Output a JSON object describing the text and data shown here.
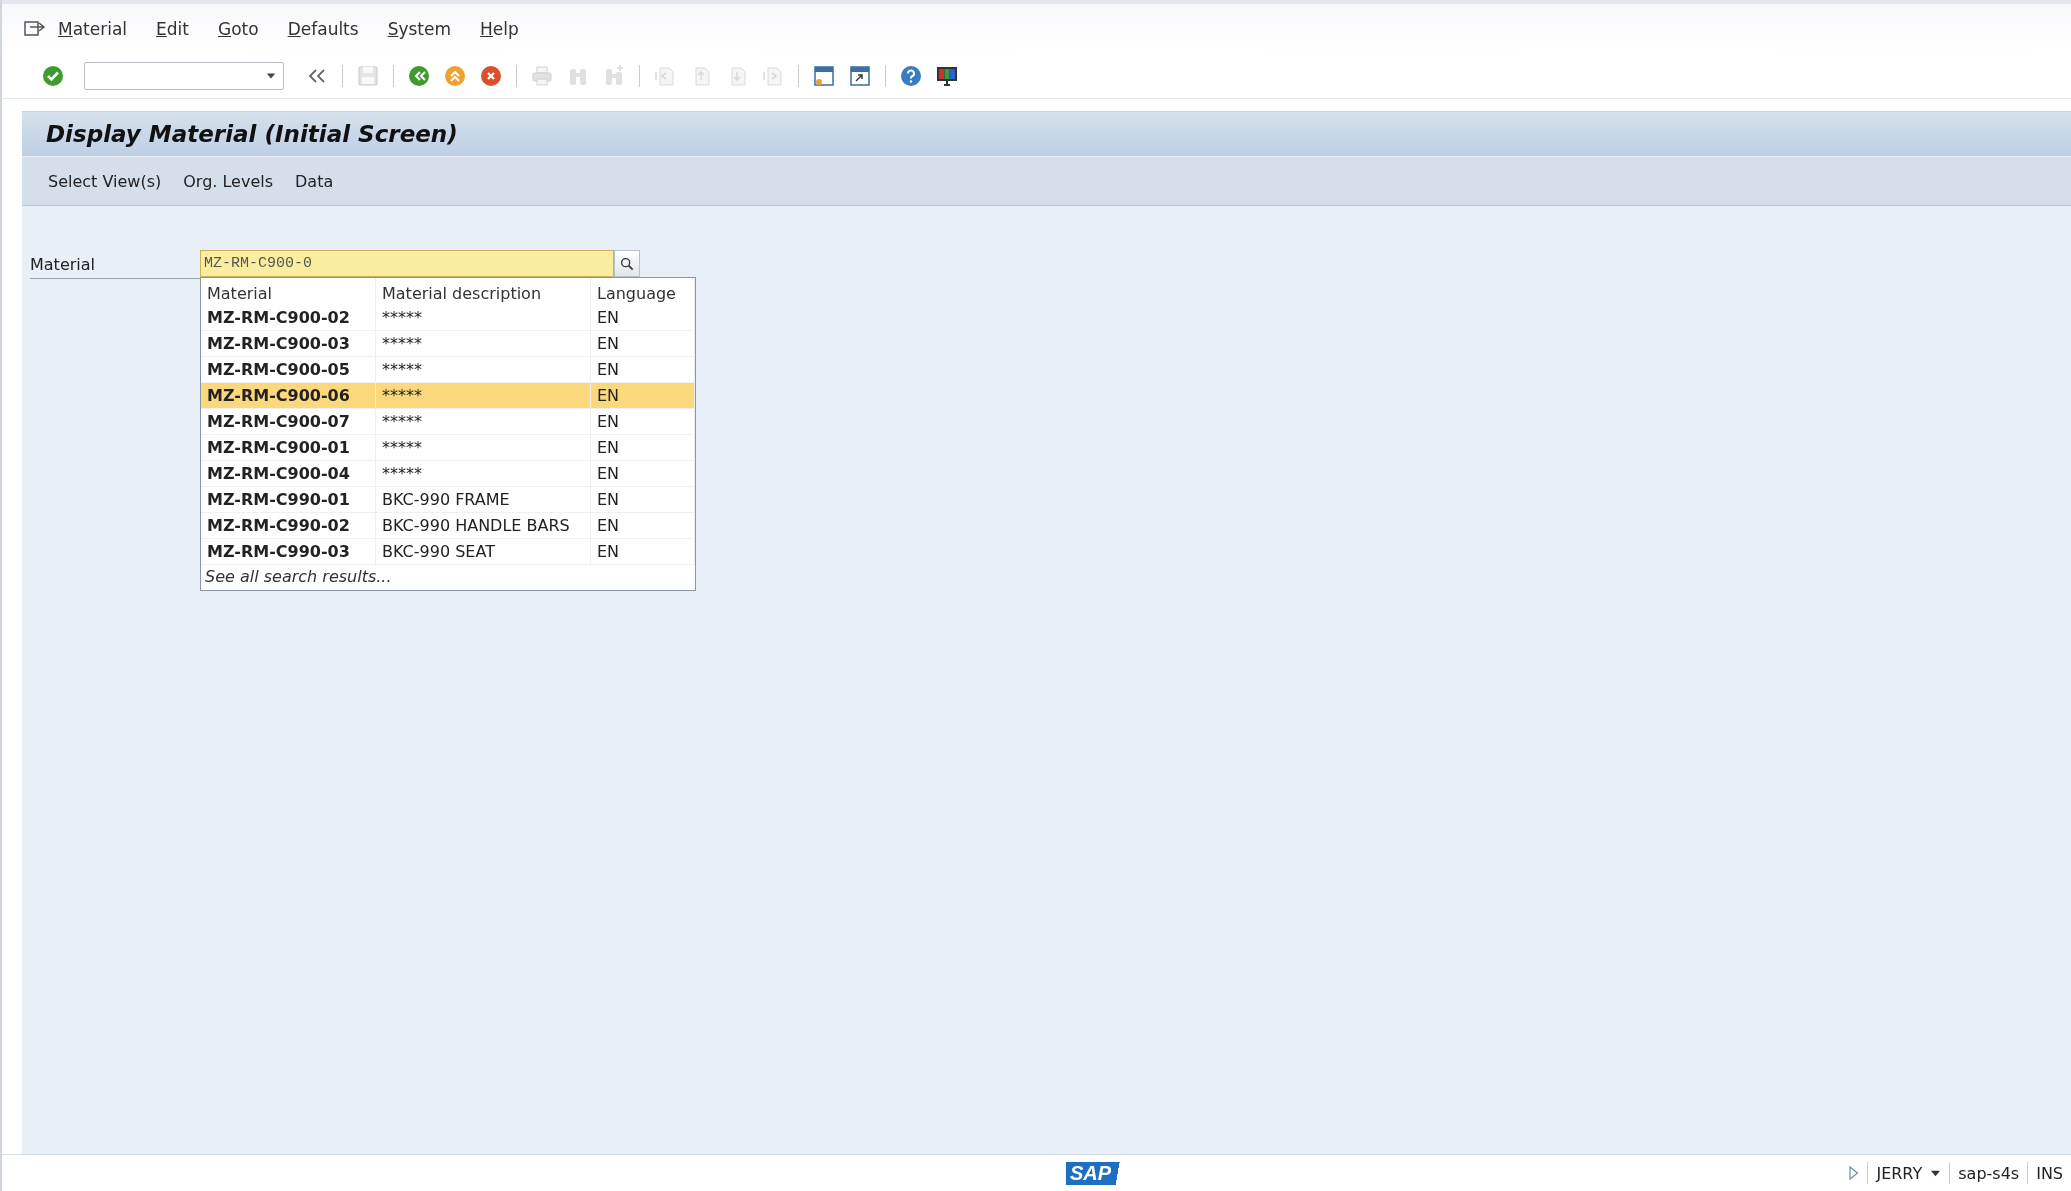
{
  "menu_bar": {
    "items": [
      "Material",
      "Edit",
      "Goto",
      "Defaults",
      "System",
      "Help"
    ]
  },
  "toolbar": {
    "buttons": [
      {
        "kind": "enter",
        "disabled": false
      },
      {
        "kind": "command-toggle",
        "disabled": false
      },
      {
        "kind": "save",
        "disabled": true
      },
      {
        "kind": "back",
        "disabled": false
      },
      {
        "kind": "exit",
        "disabled": false
      },
      {
        "kind": "cancel",
        "disabled": false
      },
      {
        "kind": "print",
        "disabled": true
      },
      {
        "kind": "find",
        "disabled": true
      },
      {
        "kind": "find-next",
        "disabled": true
      },
      {
        "kind": "first-page",
        "disabled": true
      },
      {
        "kind": "previous-page",
        "disabled": true
      },
      {
        "kind": "next-page",
        "disabled": true
      },
      {
        "kind": "last-page",
        "disabled": true
      },
      {
        "kind": "new-session",
        "disabled": false
      },
      {
        "kind": "shortcut",
        "disabled": false
      },
      {
        "kind": "help",
        "disabled": false
      },
      {
        "kind": "layout",
        "disabled": false
      }
    ]
  },
  "screen": {
    "title": "Display Material (Initial Screen)",
    "app_toolbar": [
      "Select View(s)",
      "Org. Levels",
      "Data"
    ],
    "material_field": {
      "label": "Material",
      "value": "MZ-RM-C900-0"
    },
    "suggestions": {
      "columns": [
        "Material",
        "Material description",
        "Language"
      ],
      "rows": [
        {
          "material": "MZ-RM-C900-02",
          "description": "*****",
          "language": "EN",
          "selected": false
        },
        {
          "material": "MZ-RM-C900-03",
          "description": "*****",
          "language": "EN",
          "selected": false
        },
        {
          "material": "MZ-RM-C900-05",
          "description": "*****",
          "language": "EN",
          "selected": false
        },
        {
          "material": "MZ-RM-C900-06",
          "description": "*****",
          "language": "EN",
          "selected": true
        },
        {
          "material": "MZ-RM-C900-07",
          "description": "*****",
          "language": "EN",
          "selected": false
        },
        {
          "material": "MZ-RM-C900-01",
          "description": "*****",
          "language": "EN",
          "selected": false
        },
        {
          "material": "MZ-RM-C900-04",
          "description": "*****",
          "language": "EN",
          "selected": false
        },
        {
          "material": "MZ-RM-C990-01",
          "description": "BKC-990 FRAME",
          "language": "EN",
          "selected": false
        },
        {
          "material": "MZ-RM-C990-02",
          "description": "BKC-990 HANDLE BARS",
          "language": "EN",
          "selected": false
        },
        {
          "material": "MZ-RM-C990-03",
          "description": "BKC-990 SEAT",
          "language": "EN",
          "selected": false
        }
      ],
      "footer": "See all search results..."
    }
  },
  "status_bar": {
    "logo": "SAP",
    "user": "JERRY",
    "system": "sap-s4s",
    "mode": "INS"
  }
}
